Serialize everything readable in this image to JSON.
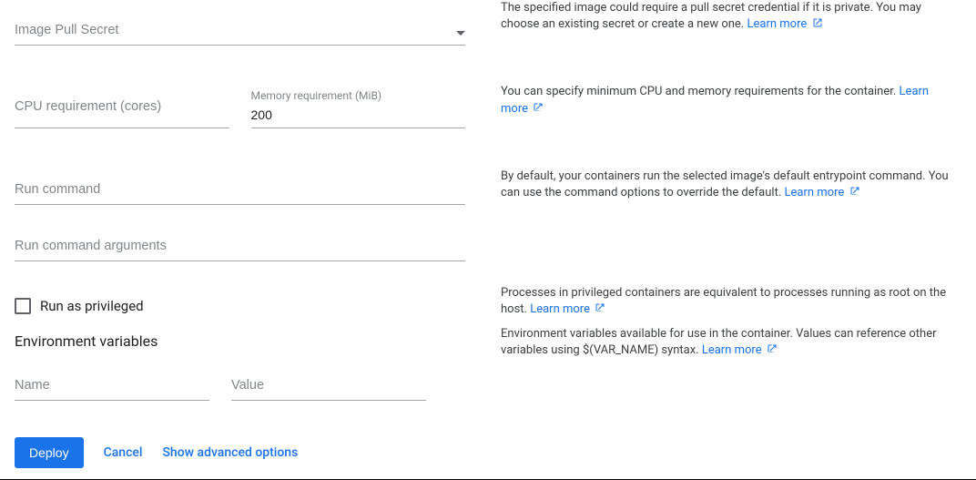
{
  "link_color": "#1a73e8",
  "learn_more_label": "Learn more",
  "left": {
    "image_pull_secret": {
      "placeholder": "Image Pull Secret"
    },
    "cpu": {
      "placeholder": "CPU requirement (cores)"
    },
    "memory": {
      "label": "Memory requirement (MiB)",
      "value": "200"
    },
    "run_command": {
      "placeholder": "Run command"
    },
    "run_args": {
      "placeholder": "Run command arguments"
    },
    "privileged_label": "Run as privileged",
    "env_title": "Environment variables",
    "env_name_placeholder": "Name",
    "env_value_placeholder": "Value"
  },
  "right": {
    "image_pull_secret": "The specified image could require a pull secret credential if it is private. You may choose an existing secret or create a new one.",
    "resources": "You can specify minimum CPU and memory requirements for the container.",
    "run": "By default, your containers run the selected image's default entrypoint command. You can use the command options to override the default.",
    "privileged": "Processes in privileged containers are equivalent to processes running as root on the host.",
    "env": "Environment variables available for use in the container. Values can reference other variables using $(VAR_NAME) syntax."
  },
  "footer": {
    "deploy": "Deploy",
    "cancel": "Cancel",
    "advanced": "Show advanced options"
  }
}
